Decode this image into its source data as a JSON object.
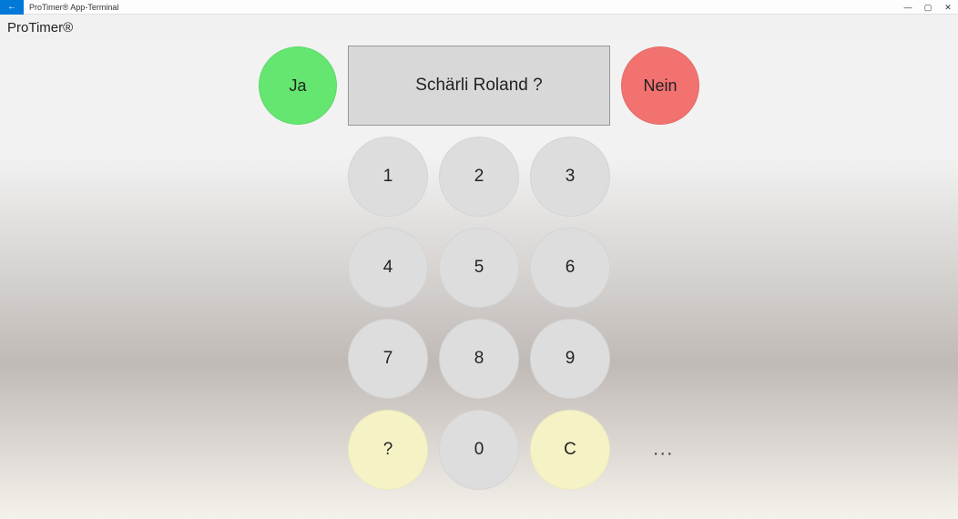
{
  "window": {
    "title": "ProTimer® App-Terminal",
    "minimize": "—",
    "maximize": "▢",
    "close": "✕",
    "back": "←"
  },
  "header": {
    "title": "ProTimer®"
  },
  "confirm": {
    "yes_label": "Ja",
    "no_label": "Nein",
    "display_text": "Schärli Roland ?"
  },
  "keypad": {
    "keys": [
      [
        "1",
        "2",
        "3"
      ],
      [
        "4",
        "5",
        "6"
      ],
      [
        "7",
        "8",
        "9"
      ],
      [
        "?",
        "0",
        "C"
      ]
    ],
    "more": "..."
  }
}
